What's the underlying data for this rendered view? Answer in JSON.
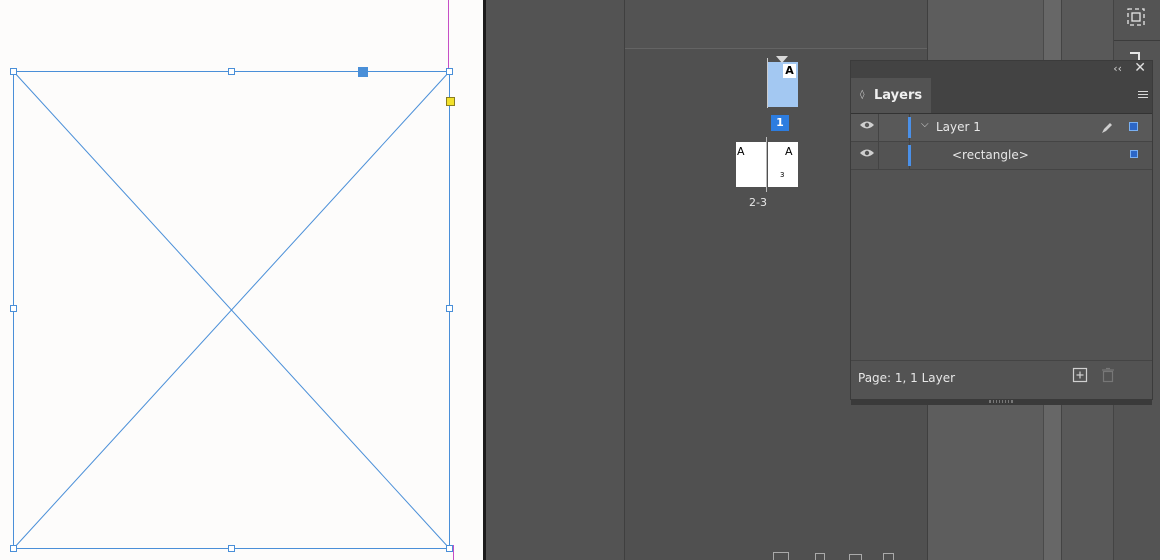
{
  "pages_panel": {
    "pages": [
      {
        "label": "1",
        "master": "A"
      },
      {
        "label": "2-3",
        "masters": [
          "A",
          "A"
        ],
        "page_number": "3"
      }
    ]
  },
  "layers_panel": {
    "tab_title": "Layers",
    "layers": [
      {
        "name": "Layer 1",
        "expanded": true,
        "color": "#4a90e8"
      },
      {
        "name": "<rectangle>",
        "indent": 1,
        "color": "#4a90e8"
      }
    ],
    "footer_status": "Page: 1, 1 Layer"
  },
  "colors": {
    "selection": "#4a8fd8",
    "layer_color": "#4a90e8",
    "panel_bg": "#535353",
    "canvas_bg": "#fdfcfb"
  }
}
